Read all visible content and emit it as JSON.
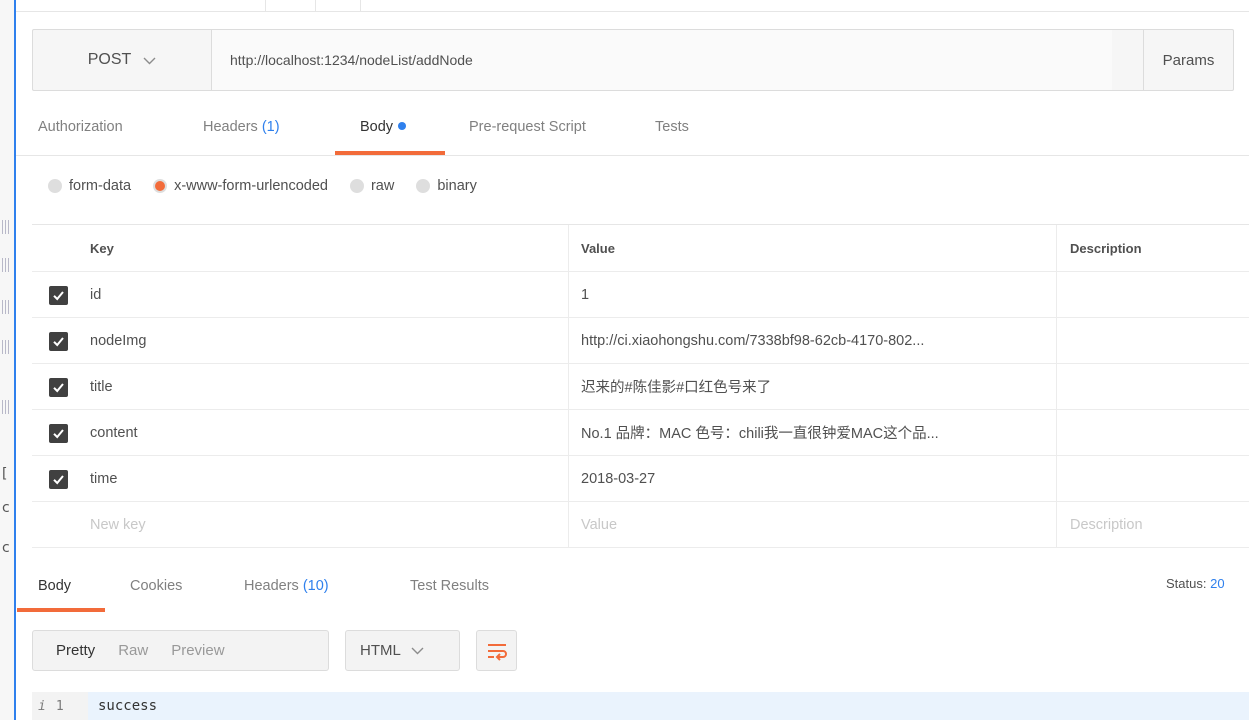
{
  "request": {
    "method": "POST",
    "url": "http://localhost:1234/nodeList/addNode",
    "params_label": "Params"
  },
  "request_tabs": {
    "authorization": "Authorization",
    "headers": "Headers",
    "headers_count": "(1)",
    "body": "Body",
    "prerequest": "Pre-request Script",
    "tests": "Tests"
  },
  "body_types": [
    "form-data",
    "x-www-form-urlencoded",
    "raw",
    "binary"
  ],
  "table": {
    "headers": {
      "key": "Key",
      "value": "Value",
      "description": "Description"
    },
    "rows": [
      {
        "key": "id",
        "value": "1"
      },
      {
        "key": "nodeImg",
        "value": "http://ci.xiaohongshu.com/7338bf98-62cb-4170-802..."
      },
      {
        "key": "title",
        "value": "迟来的#陈佳影#口红色号来了"
      },
      {
        "key": "content",
        "value": "No.1 品牌：MAC 色号：chili我一直很钟爱MAC这个品..."
      },
      {
        "key": "time",
        "value": "2018-03-27"
      }
    ],
    "placeholders": {
      "key": "New key",
      "value": "Value",
      "description": "Description"
    }
  },
  "response_tabs": {
    "body": "Body",
    "cookies": "Cookies",
    "headers": "Headers",
    "headers_count": "(10)",
    "test_results": "Test Results"
  },
  "status": {
    "label": "Status:",
    "code": "20"
  },
  "format": {
    "pretty": "Pretty",
    "raw": "Raw",
    "preview": "Preview",
    "language": "HTML"
  },
  "response": {
    "info_glyph": "i",
    "line_number": "1",
    "text": "success"
  },
  "colors": {
    "accent": "#f26b3a",
    "link": "#2f80ed",
    "checkbox": "#404040"
  },
  "icons": {
    "method_dropdown": "chevron-down-icon",
    "wrap": "wrap-lines-icon",
    "check": "check-icon"
  },
  "left_strip": {
    "glyph": "[",
    "letter": "c"
  }
}
